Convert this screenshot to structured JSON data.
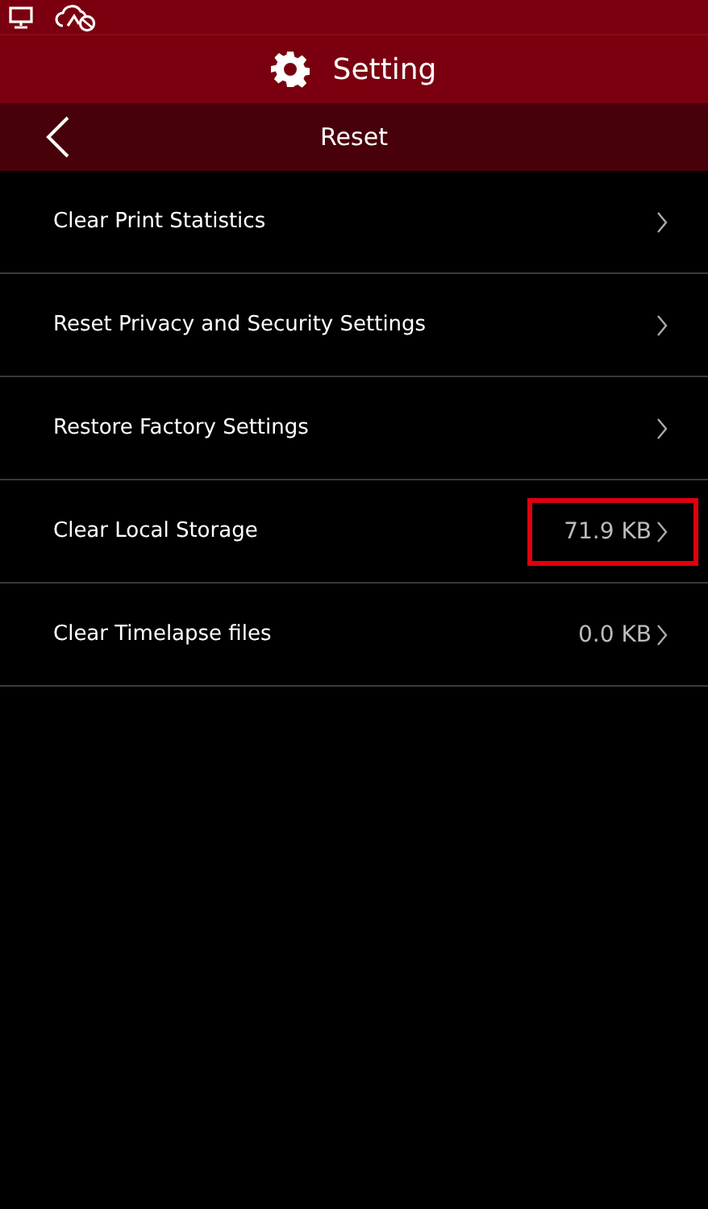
{
  "header": {
    "title": "Setting"
  },
  "subheader": {
    "title": "Reset"
  },
  "items": [
    {
      "label": "Clear Print Statistics",
      "highlighted": false
    },
    {
      "label": "Reset Privacy and Security Settings",
      "highlighted": false
    },
    {
      "label": "Restore Factory Settings",
      "highlighted": false
    },
    {
      "label": "Clear Local Storage",
      "value": "71.9 KB",
      "highlighted": true
    },
    {
      "label": "Clear Timelapse files",
      "value": "0.0 KB",
      "highlighted": false
    }
  ]
}
